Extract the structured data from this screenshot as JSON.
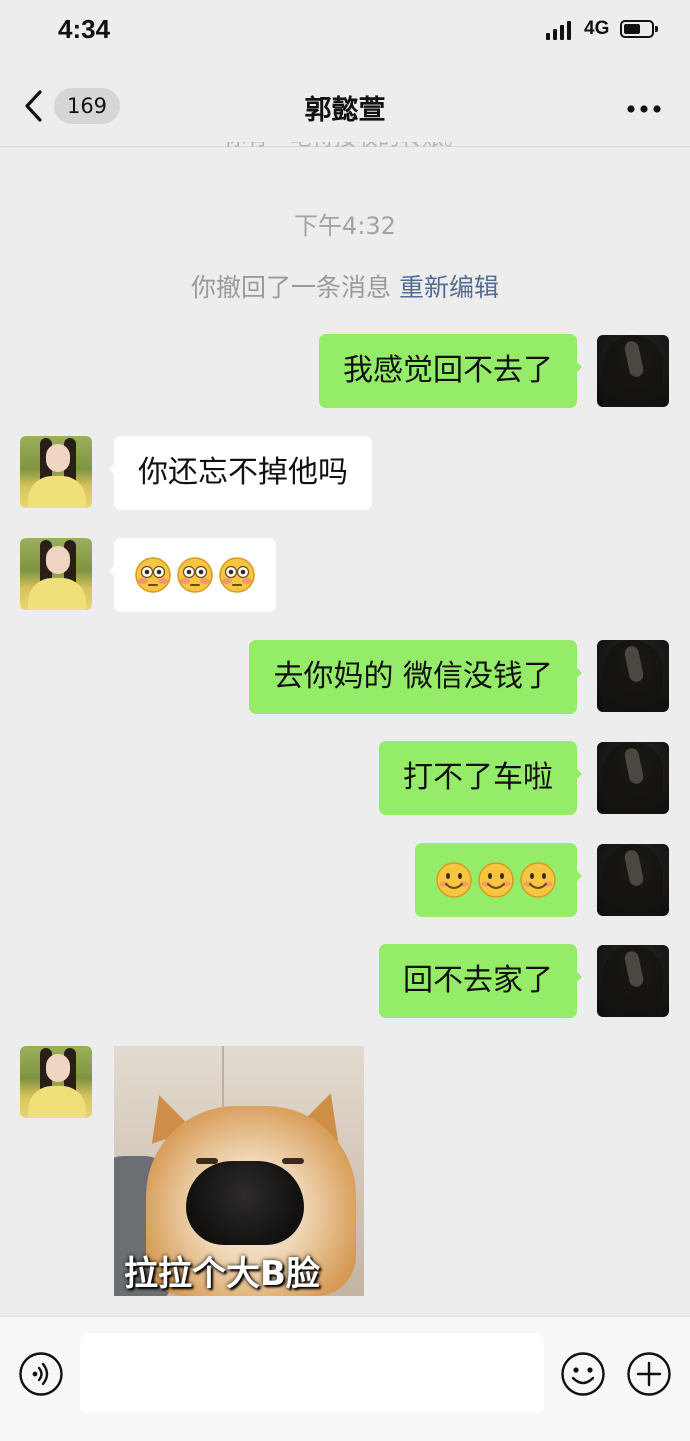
{
  "status_bar": {
    "time": "4:34",
    "network": "4G"
  },
  "header": {
    "unread_count": "169",
    "title": "郭懿萱"
  },
  "chat": {
    "partial_prev_notice": "你有一笔待接收的转账。",
    "timestamp": "下午4:32",
    "system_notice": {
      "text": "你撤回了一条消息",
      "action": "重新编辑"
    },
    "messages": [
      {
        "sender": "me",
        "text": "我感觉回不去了"
      },
      {
        "sender": "contact",
        "text": "你还忘不掉他吗"
      },
      {
        "sender": "contact",
        "emoji": [
          "flushed-face",
          "flushed-face",
          "flushed-face"
        ]
      },
      {
        "sender": "me",
        "text": "去你妈的 微信没钱了"
      },
      {
        "sender": "me",
        "text": "打不了车啦"
      },
      {
        "sender": "me",
        "emoji": [
          "smiling-face",
          "smiling-face",
          "smiling-face"
        ]
      },
      {
        "sender": "me",
        "text": "回不去家了"
      },
      {
        "sender": "contact",
        "sticker_caption": "拉拉个大B脸"
      }
    ]
  },
  "colors": {
    "my_bubble": "#95ec69",
    "contact_bubble": "#ffffff",
    "background": "#ededed",
    "link": "#576b95"
  },
  "input_bar": {
    "text": ""
  }
}
